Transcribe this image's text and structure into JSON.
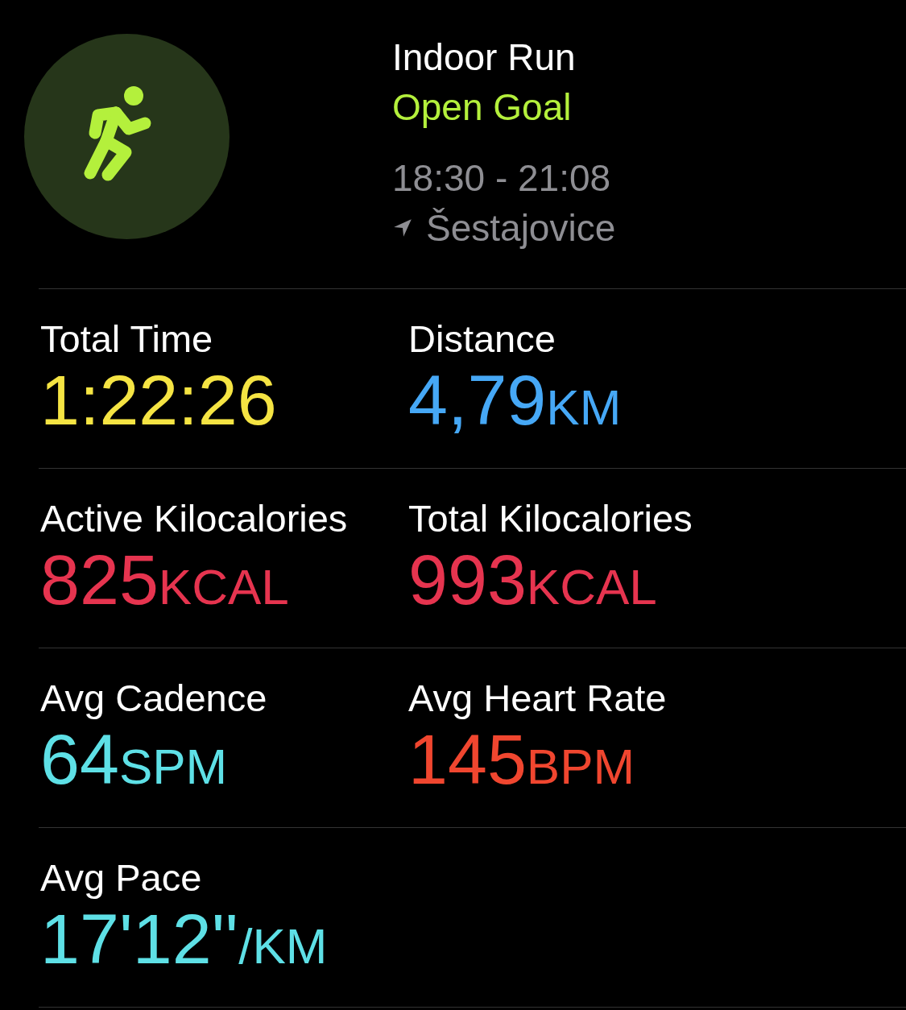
{
  "workout": {
    "title": "Indoor Run",
    "goal": "Open Goal",
    "time_range": "18:30 - 21:08",
    "location": "Šestajovice"
  },
  "metric_rows": [
    [
      {
        "label": "Total Time",
        "value": "1:22:26",
        "color": "#f5e443"
      },
      {
        "label": "Distance",
        "value": "4,79",
        "unit": "KM",
        "color": "#46a8f6"
      }
    ],
    [
      {
        "label": "Active Kilocalories",
        "value": "825",
        "unit": "KCAL",
        "color": "#e6344f"
      },
      {
        "label": "Total Kilocalories",
        "value": "993",
        "unit": "KCAL",
        "color": "#e6344f"
      }
    ],
    [
      {
        "label": "Avg Cadence",
        "value": "64",
        "unit": "SPM",
        "color": "#5ee0e6"
      },
      {
        "label": "Avg Heart Rate",
        "value": "145",
        "unit": "BPM",
        "color": "#f0462f"
      }
    ],
    [
      {
        "label": "Avg Pace",
        "value": "17'12''",
        "unit": "/KM",
        "color": "#5ee0e6"
      }
    ]
  ]
}
